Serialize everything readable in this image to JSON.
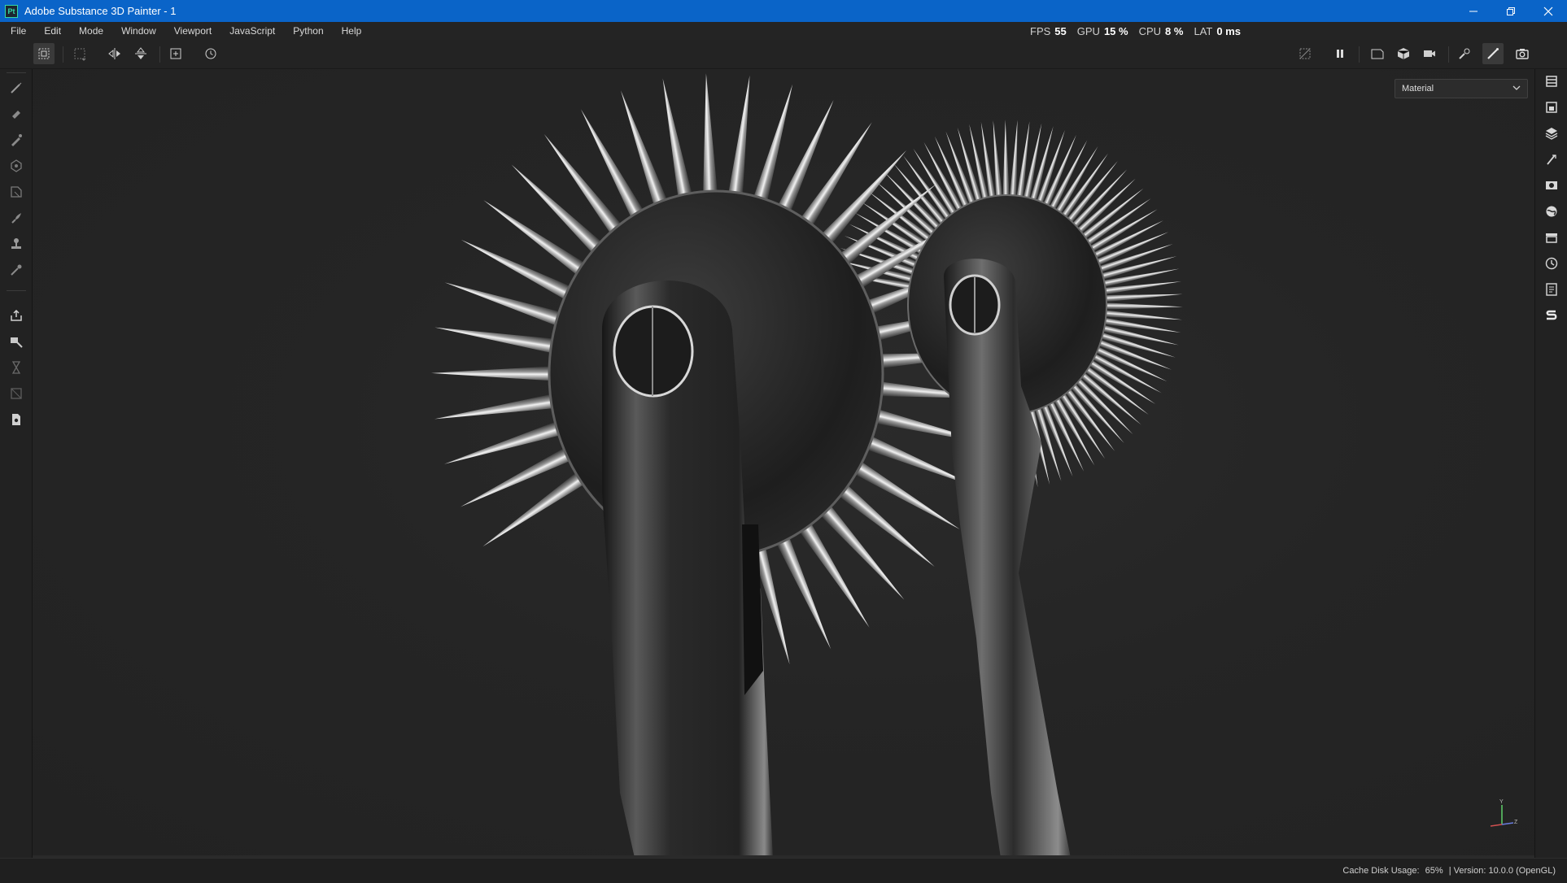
{
  "window": {
    "logo": "Pt",
    "title": "Adobe Substance 3D Painter - 1",
    "controls": [
      "minimize-icon",
      "restore-icon",
      "close-icon"
    ]
  },
  "menu": {
    "items": [
      "File",
      "Edit",
      "Mode",
      "Window",
      "Viewport",
      "JavaScript",
      "Python",
      "Help"
    ]
  },
  "performance": {
    "fps_label": "FPS",
    "fps_value": "55",
    "gpu_label": "GPU",
    "gpu_value": "15 %",
    "cpu_label": "CPU",
    "cpu_value": "8 %",
    "lat_label": "LAT",
    "lat_value": "0 ms"
  },
  "toolbar": {
    "left_icons": [
      "object-selection-icon",
      "projection-icon",
      "symmetry-x-icon",
      "symmetry-y-icon",
      "add-camera-icon",
      "reset-icon"
    ],
    "right_icons": [
      "hide-mesh-icon",
      "pause-icon",
      "viewport-view-icon",
      "3d-view-icon",
      "camera-icon",
      "brush-settings-icon",
      "paint-mode-icon",
      "screenshot-icon"
    ]
  },
  "left_tools": [
    "paint-brush-icon",
    "eraser-icon",
    "projection-tool-icon",
    "polygon-fill-icon",
    "geometry-mask-icon",
    "smudge-icon",
    "clone-stamp-icon",
    "color-picker-icon",
    "bake-icon",
    "uv-tool-icon",
    "hourglass-icon",
    "material-pick-icon",
    "export-icon"
  ],
  "right_panels": [
    "layers-panel-icon",
    "texture-set-icon",
    "layer-stack-icon",
    "properties-icon",
    "display-settings-icon",
    "environment-icon",
    "shelf-icon",
    "history-icon",
    "log-icon",
    "substance-source-icon"
  ],
  "viewport": {
    "channel_select": "Material",
    "gizmo": {
      "y": "Y",
      "z": "Z"
    }
  },
  "status": {
    "cache_label": "Cache Disk Usage:",
    "cache_value": "65%",
    "version": "| Version: 10.0.0 (OpenGL)"
  }
}
